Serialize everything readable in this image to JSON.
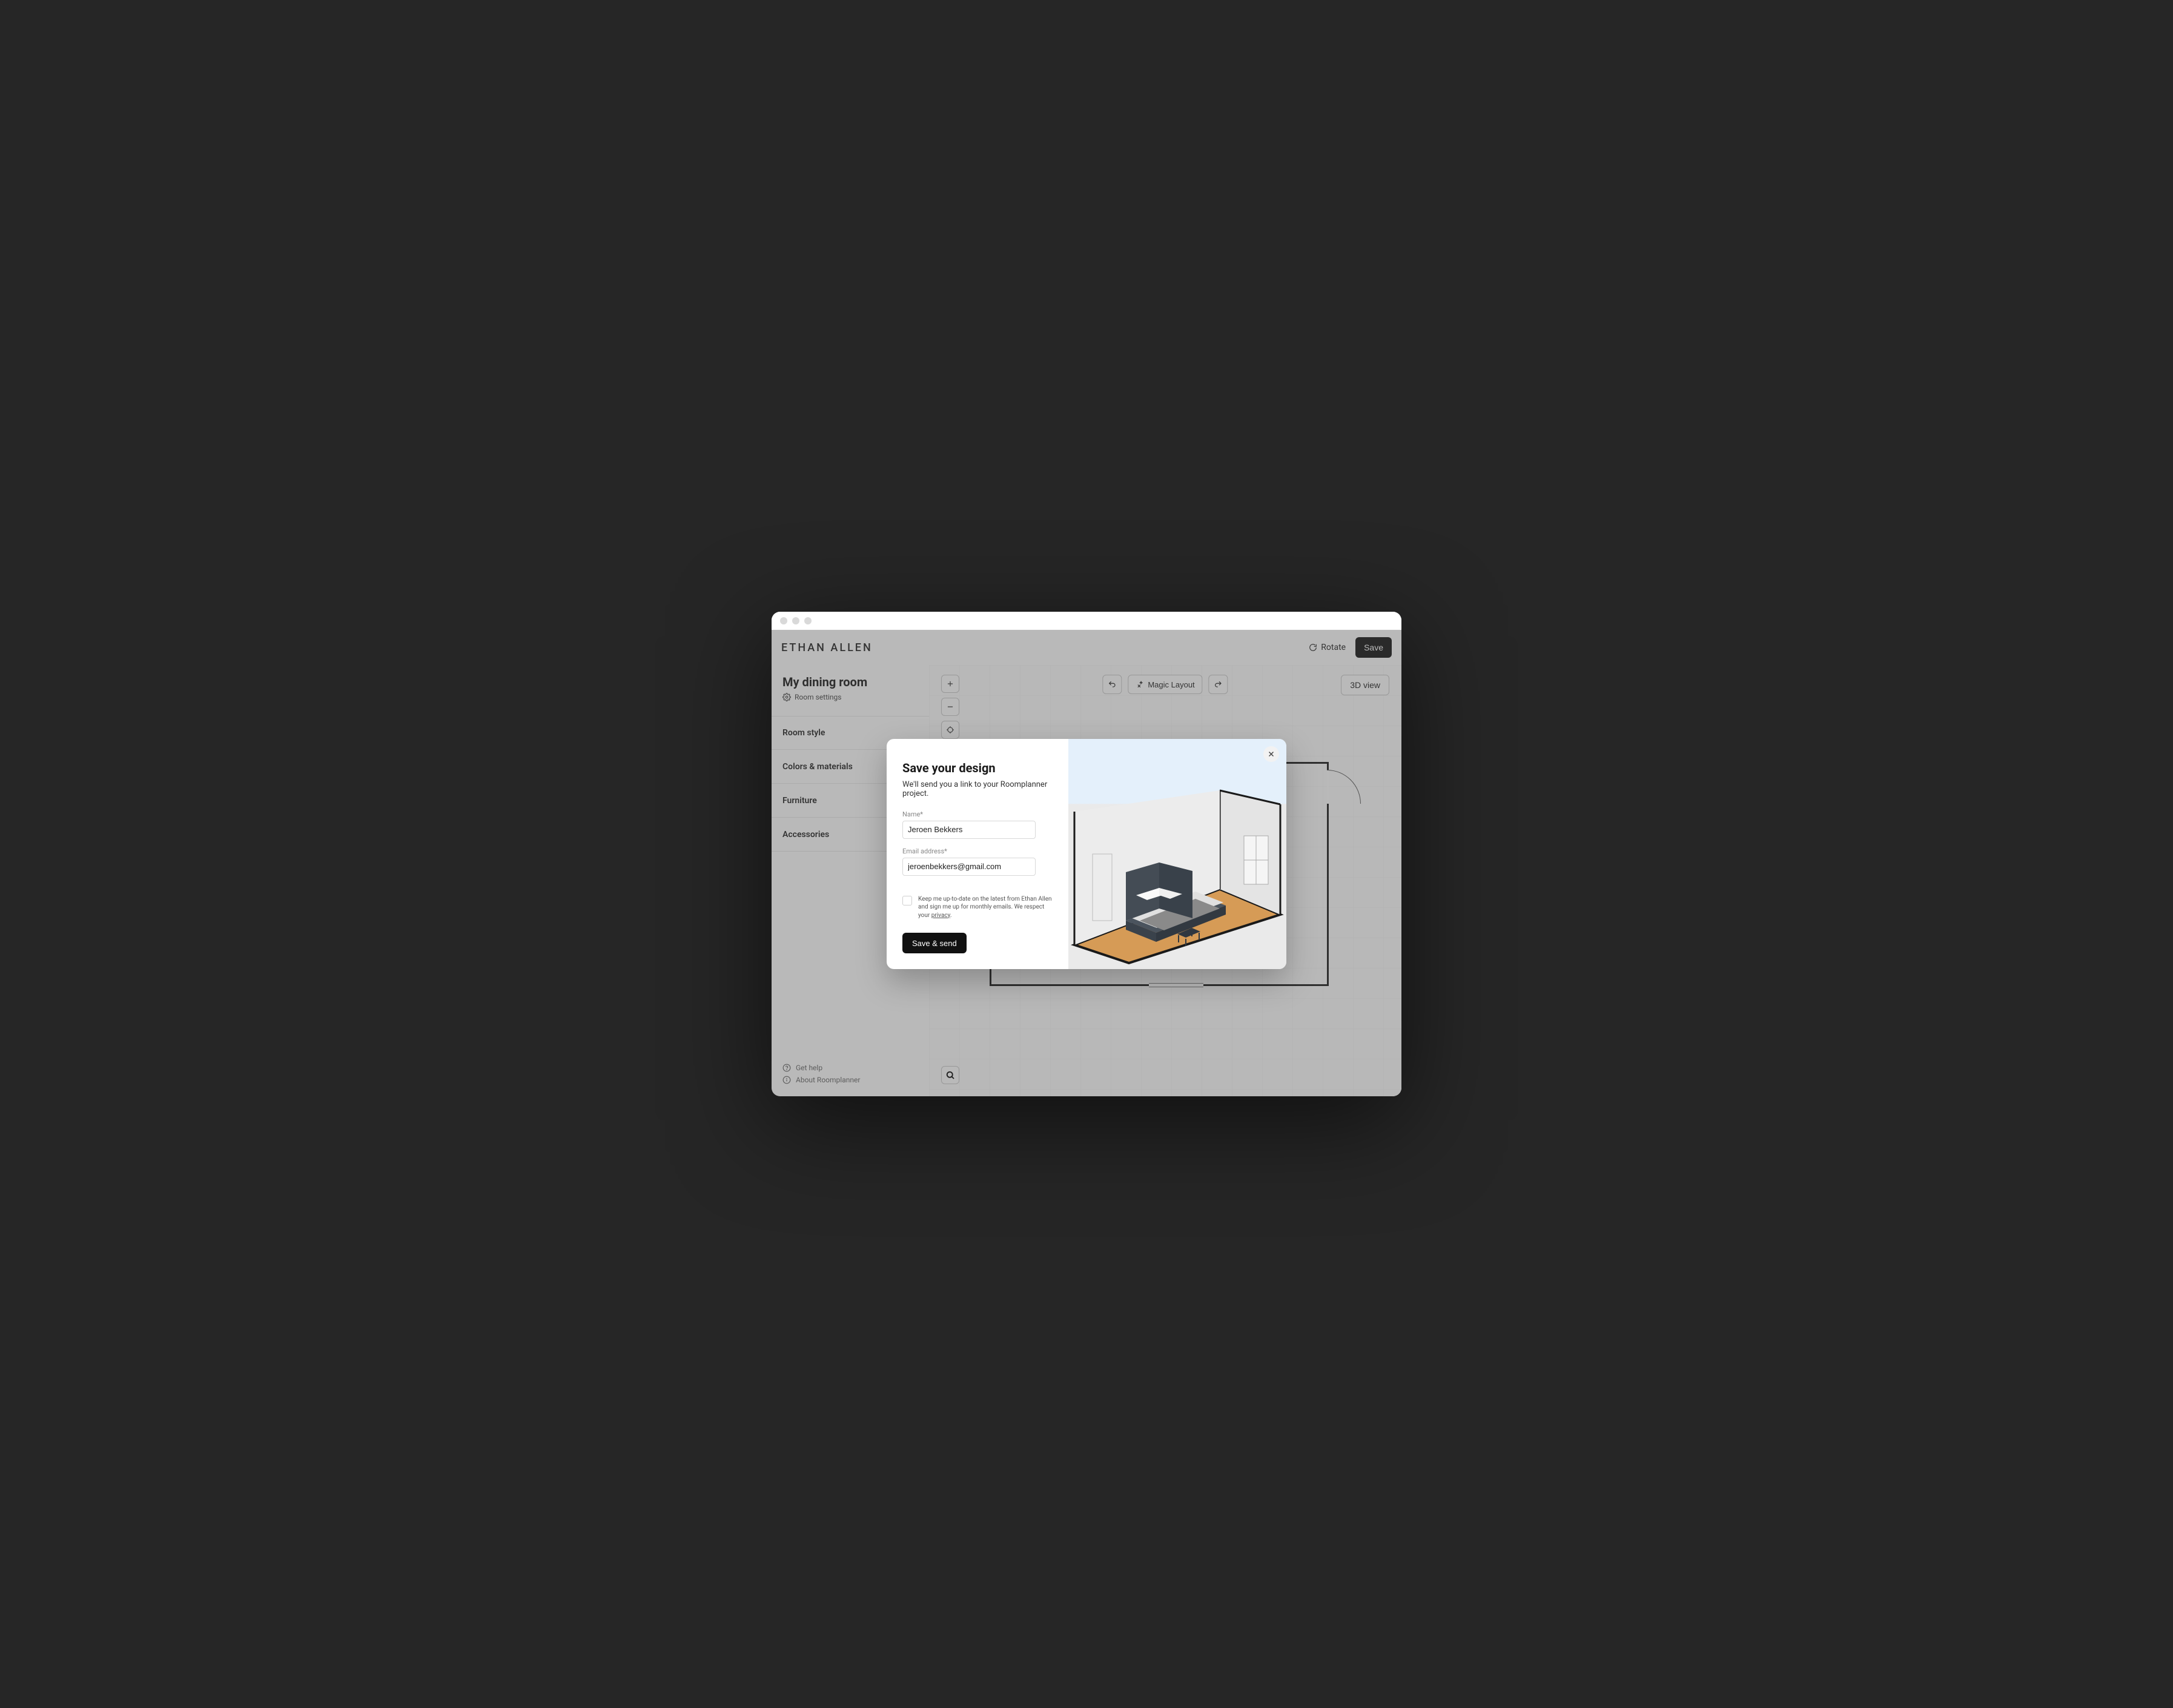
{
  "brand": "ETHAN ALLEN",
  "topbar": {
    "rotate_label": "Rotate",
    "save_label": "Save"
  },
  "room": {
    "title": "My dining room",
    "settings_label": "Room settings"
  },
  "sidebar": {
    "items": [
      {
        "label": "Room style"
      },
      {
        "label": "Colors & materials"
      },
      {
        "label": "Furniture"
      },
      {
        "label": "Accessories"
      }
    ],
    "footer": {
      "help_label": "Get help",
      "about_label": "About Roomplanner"
    }
  },
  "canvas": {
    "magic_layout_label": "Magic Layout",
    "view_label": "3D view"
  },
  "modal": {
    "title": "Save your design",
    "subtitle": "We'll send you a link to your Roomplanner project.",
    "name_label": "Name*",
    "name_value": "Jeroen Bekkers",
    "email_label": "Email address*",
    "email_value": "jeroenbekkers@gmail.com",
    "consent_text_prefix": "Keep me up-to-date on the latest from Ethan Allen and sign me up for monthly emails. We respect your ",
    "consent_privacy_word": "privacy",
    "consent_text_suffix": ".",
    "submit_label": "Save & send"
  }
}
